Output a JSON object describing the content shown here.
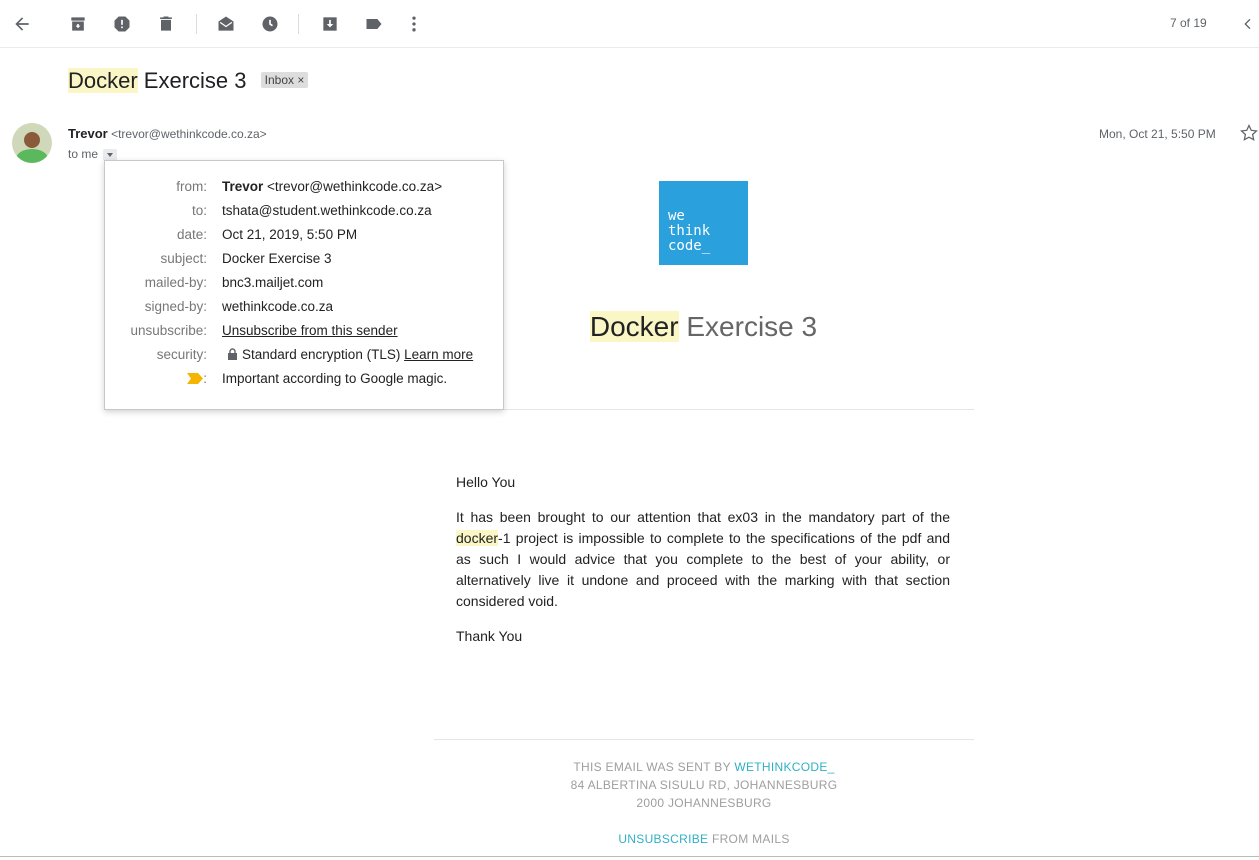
{
  "toolbar": {
    "pager": "7 of 19",
    "icons": [
      "back-arrow-icon",
      "archive-icon",
      "report-spam-icon",
      "delete-icon",
      "mark-unread-icon",
      "snooze-icon",
      "move-to-icon",
      "label-icon",
      "more-vert-icon",
      "prev-chevron-icon"
    ]
  },
  "email": {
    "subject_hl": "Docker",
    "subject_rest": " Exercise 3",
    "label": "Inbox",
    "label_close": "×",
    "sender_name": "Trevor",
    "sender_email": "<trevor@wethinkcode.co.za>",
    "to_me": "to me",
    "date": "Mon, Oct 21, 5:50 PM"
  },
  "details": {
    "from_label": "from:",
    "from_name": "Trevor",
    "from_email": " <trevor@wethinkcode.co.za>",
    "to_label": "to:",
    "to_value": "tshata@student.wethinkcode.co.za",
    "date_label": "date:",
    "date_value": "Oct 21, 2019, 5:50 PM",
    "subject_label": "subject:",
    "subject_value": "Docker Exercise 3",
    "mailedby_label": "mailed-by:",
    "mailedby_value": "bnc3.mailjet.com",
    "signedby_label": "signed-by:",
    "signedby_value": "wethinkcode.co.za",
    "unsub_label": "unsubscribe:",
    "unsub_value": "Unsubscribe from this sender",
    "security_label": "security:",
    "security_value": "Standard encryption (TLS) ",
    "security_link": "Learn more",
    "important_colon": ":",
    "important_value": "Important according to Google magic."
  },
  "content": {
    "logo_line1": "we",
    "logo_line2": "think",
    "logo_line3": "code_",
    "title_hl": "Docker",
    "title_rest": " Exercise 3",
    "greeting": "Hello You",
    "para_start": "It has been brought to our attention that ex03 in the mandatory part of the ",
    "para_hl": "docker",
    "para_end": "-1 project is impossible to complete to the specifications of the pdf and as such I would advice that you complete to the best of your ability, or alternatively live it undone and proceed with the marking with that section considered void.",
    "thanks": "Thank You"
  },
  "footer": {
    "sent_by": "THIS EMAIL WAS SENT BY ",
    "sent_by_link": "WETHINKCODE_",
    "address1": "84 ALBERTINA SISULU RD, JOHANNESBURG",
    "address2": "2000 JOHANNESBURG",
    "unsub_link": "UNSUBSCRIBE",
    "unsub_rest": " FROM MAILS"
  },
  "colors": {
    "highlight": "#fbf6c6",
    "logo_blue": "#2aa0dc",
    "footer_link": "#2fb0c5",
    "important_marker": "#f4b400"
  }
}
